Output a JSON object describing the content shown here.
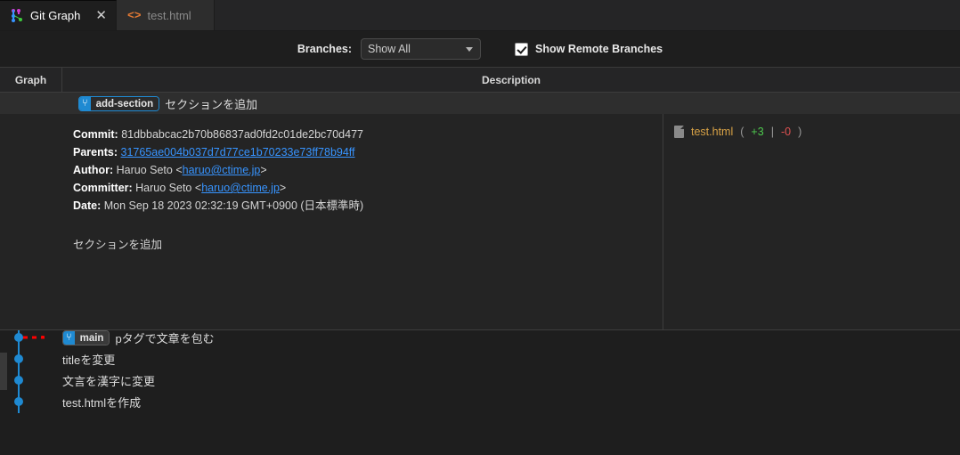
{
  "tabs": [
    {
      "label": "Git Graph",
      "icon": "git-graph-icon",
      "active": true,
      "close": "✕"
    },
    {
      "label": "test.html",
      "icon": "html-file-icon",
      "active": false
    }
  ],
  "controls": {
    "branches_label": "Branches:",
    "branches_value": "Show All",
    "show_remote_label": "Show Remote Branches",
    "show_remote_checked": true
  },
  "table": {
    "col_graph": "Graph",
    "col_description": "Description"
  },
  "commits": [
    {
      "subject": "セクションを追加",
      "ref": "add-section",
      "ref_type": "head",
      "selected": true
    },
    {
      "subject": "pタグで文章を包む",
      "ref": "main",
      "ref_type": "plain",
      "selected": false
    },
    {
      "subject": "titleを変更",
      "ref": null,
      "selected": false
    },
    {
      "subject": "文言を漢字に変更",
      "ref": null,
      "selected": false
    },
    {
      "subject": "test.htmlを作成",
      "ref": null,
      "selected": false
    }
  ],
  "details": {
    "commit_key": "Commit:",
    "commit_value": "81dbbabcac2b70b86837ad0fd2c01de2bc70d477",
    "parents_key": "Parents:",
    "parents_value": "31765ae004b037d7d77ce1b70233e73ff78b94ff",
    "author_key": "Author:",
    "author_name": "Haruo Seto",
    "author_email": "haruo@ctime.jp",
    "committer_key": "Committer:",
    "committer_name": "Haruo Seto",
    "committer_email": "haruo@ctime.jp",
    "date_key": "Date:",
    "date_value": "Mon Sep 18 2023 02:32:19 GMT+0900 (日本標準時)",
    "body": "セクションを追加",
    "files": [
      {
        "name": "test.html",
        "open_paren": "(",
        "additions": "+3",
        "separator": "|",
        "deletions": "-0",
        "close_paren": ")"
      }
    ]
  },
  "colors": {
    "graph_branch_blue": "#1f8ad2",
    "graph_branch_red": "#ff0000",
    "annotation_red": "#ff0000",
    "link_blue": "#3794ff",
    "file_name_orange": "#d8a246",
    "addition_green": "#4ec94e",
    "deletion_red": "#e05252"
  }
}
